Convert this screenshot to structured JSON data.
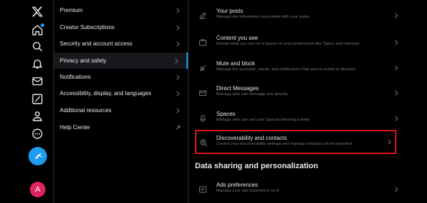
{
  "rail": {
    "icons": [
      "x-logo-icon",
      "home-icon",
      "search-icon",
      "notifications-icon",
      "messages-icon",
      "grok-icon",
      "profile-icon",
      "more-icon",
      "post-button-icon"
    ],
    "avatar_letter": "A"
  },
  "menu": {
    "items": [
      {
        "label": "Premium",
        "chevron": "chevron-right-icon"
      },
      {
        "label": "Creator Subscriptions",
        "chevron": "chevron-right-icon"
      },
      {
        "label": "Security and account access",
        "chevron": "chevron-right-icon"
      },
      {
        "label": "Privacy and safety",
        "chevron": "chevron-right-icon",
        "active": true
      },
      {
        "label": "Notifications",
        "chevron": "chevron-right-icon"
      },
      {
        "label": "Accessibility, display, and languages",
        "chevron": "chevron-right-icon"
      },
      {
        "label": "Additional resources",
        "chevron": "chevron-right-icon"
      },
      {
        "label": "Help Center",
        "chevron": "external-link-icon"
      }
    ]
  },
  "detail": {
    "rows": [
      {
        "title": "Your posts",
        "desc": "Manage the information associated with your posts.",
        "icon": "pencil-icon"
      },
      {
        "title": "Content you see",
        "desc": "Decide what you see on X based on your preferences like Topics and interests",
        "icon": "content-icon"
      },
      {
        "title": "Mute and block",
        "desc": "Manage the accounts, words, and notifications that you've muted or blocked.",
        "icon": "mute-icon"
      },
      {
        "title": "Direct Messages",
        "desc": "Manage who can message you directly.",
        "icon": "envelope-icon"
      },
      {
        "title": "Spaces",
        "desc": "Manage who can see your Spaces listening activity",
        "icon": "microphone-icon"
      },
      {
        "title": "Discoverability and contacts",
        "desc": "Control your discoverability settings and manage contacts you've imported.",
        "icon": "search-person-icon",
        "highlighted": true
      }
    ],
    "section_title": "Data sharing and personalization",
    "rows2": [
      {
        "title": "Ads preferences",
        "desc": "Manage your ads experience on X.",
        "icon": "megaphone-icon"
      }
    ]
  },
  "colors": {
    "accent": "#1d9bf0",
    "highlight": "#e0171c",
    "avatar": "#e0245e"
  }
}
